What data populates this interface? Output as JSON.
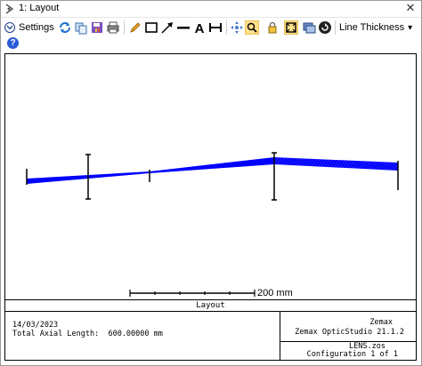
{
  "window": {
    "title": "1: Layout",
    "close_glyph": "✕"
  },
  "toolbar": {
    "settings_label": "Settings",
    "line_thickness_label": "Line Thickness",
    "dropdown_glyph": "▾",
    "icons": [
      "refresh-icon",
      "copy-icon",
      "save-icon",
      "print-icon",
      "pencil-icon",
      "rectangle-icon",
      "arrow-icon",
      "line-icon",
      "text-icon",
      "dimension-icon",
      "pan-icon",
      "zoom-icon",
      "lock-icon",
      "fit-icon",
      "window-icon",
      "export-icon"
    ]
  },
  "help": {
    "glyph": "?"
  },
  "plot": {
    "scale_bar_label": "200 mm",
    "caption": "Layout",
    "ray_color": "#0000ff"
  },
  "info": {
    "date": "14/03/2023",
    "axial_length": "Total Axial Length:  600.00000 mm",
    "company": "Zemax",
    "product": "Zemax OpticStudio 21.1.2",
    "file": "LENS.zos",
    "configuration": "Configuration 1 of 1"
  }
}
